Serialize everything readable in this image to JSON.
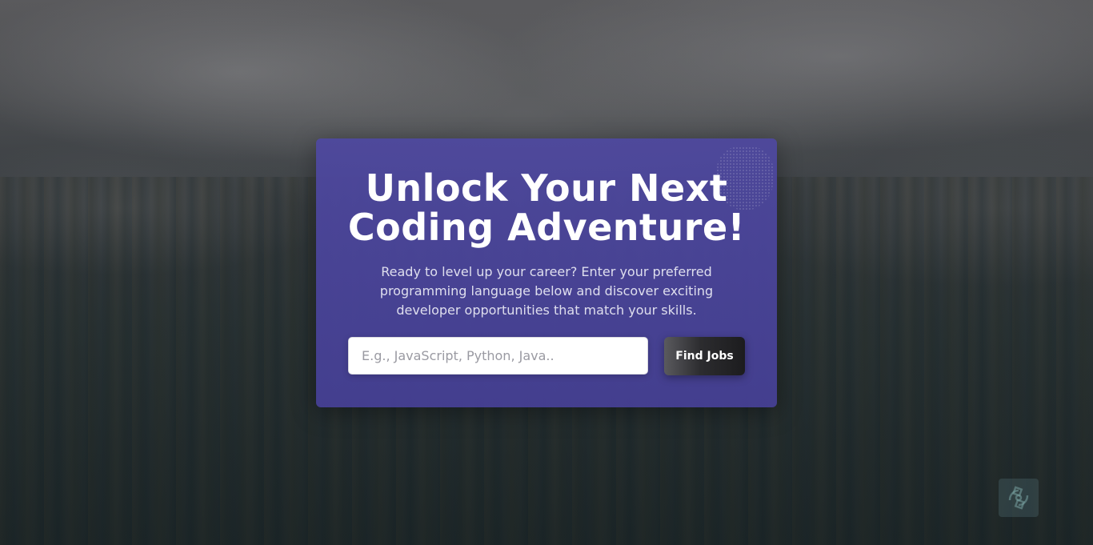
{
  "hero": {
    "title_line1": "Unlock Your Next",
    "title_line2": "Coding Adventure!",
    "description": "Ready to level up your career? Enter your preferred programming language below and discover exciting developer opportunities that match your skills."
  },
  "search": {
    "placeholder": "E.g., JavaScript, Python, Java..",
    "value": "",
    "button_label": "Find Jobs"
  },
  "colors": {
    "card": "#4e48a0",
    "button": "#2c2c2f",
    "title_text": "#ffffff"
  },
  "icons": {
    "corner_badge": "extension-logo-icon"
  }
}
